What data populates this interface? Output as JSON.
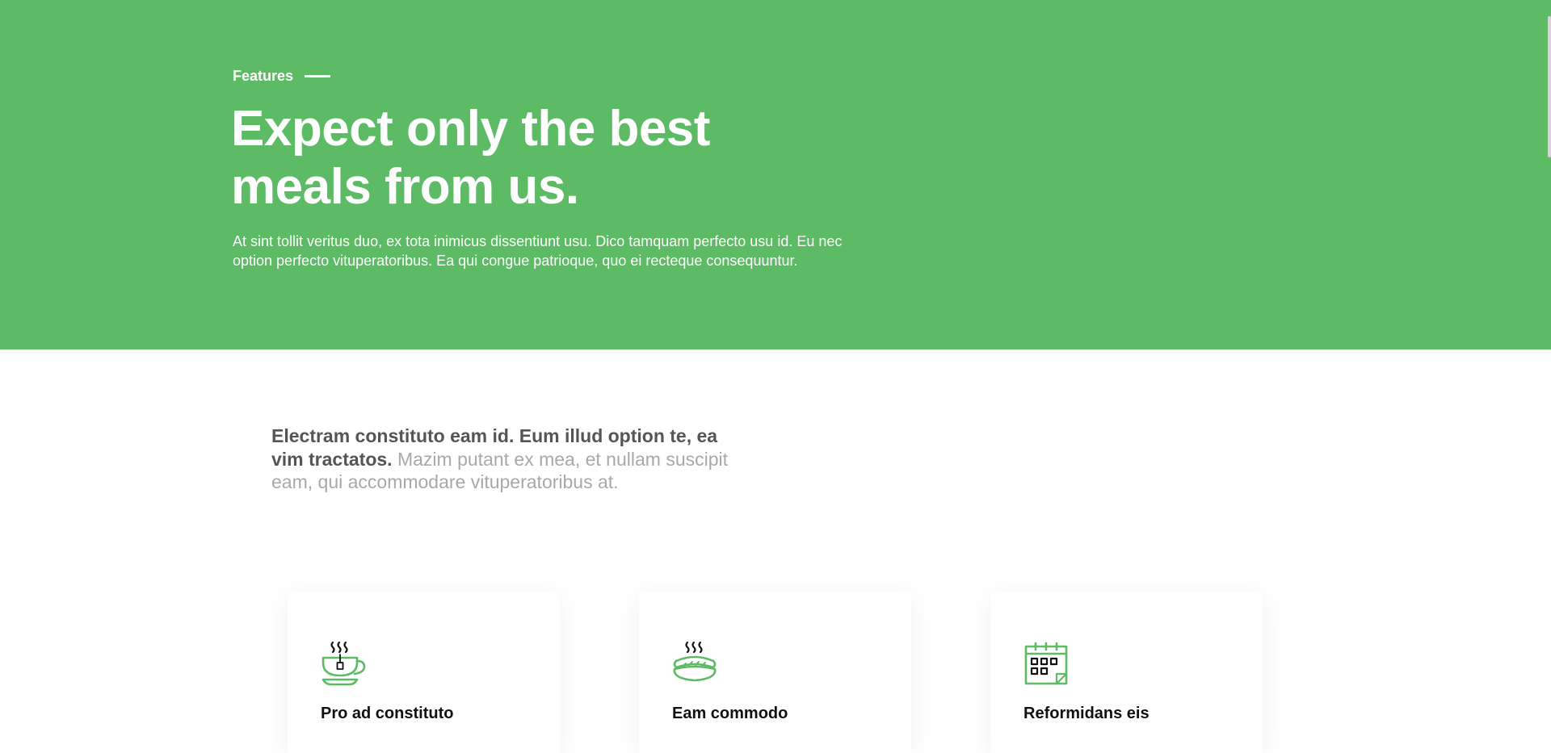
{
  "hero": {
    "eyebrow": "Features",
    "title_line1": "Expect only the best",
    "title_line2": "meals from us.",
    "description": "At sint tollit veritus duo, ex tota inimicus dissentiunt usu. Dico tamquam perfecto usu id. Eu nec option perfecto vituperatoribus. Ea qui congue patrioque, quo ei recteque consequuntur."
  },
  "intro": {
    "bold": "Electram constituto eam id. Eum illud option te, ea vim tractatos.",
    "light": "Mazim putant ex mea, et nullam suscipit eam, qui accommodare vituperatoribus at."
  },
  "features": [
    {
      "icon": "tea-cup-icon",
      "title": "Pro ad constituto"
    },
    {
      "icon": "hot-sausage-icon",
      "title": "Eam commodo"
    },
    {
      "icon": "calendar-icon",
      "title": "Reformidans eis"
    }
  ],
  "colors": {
    "brand_green": "#5cbb64",
    "heading_dark": "#555555",
    "text_light": "#a8a8a8"
  }
}
